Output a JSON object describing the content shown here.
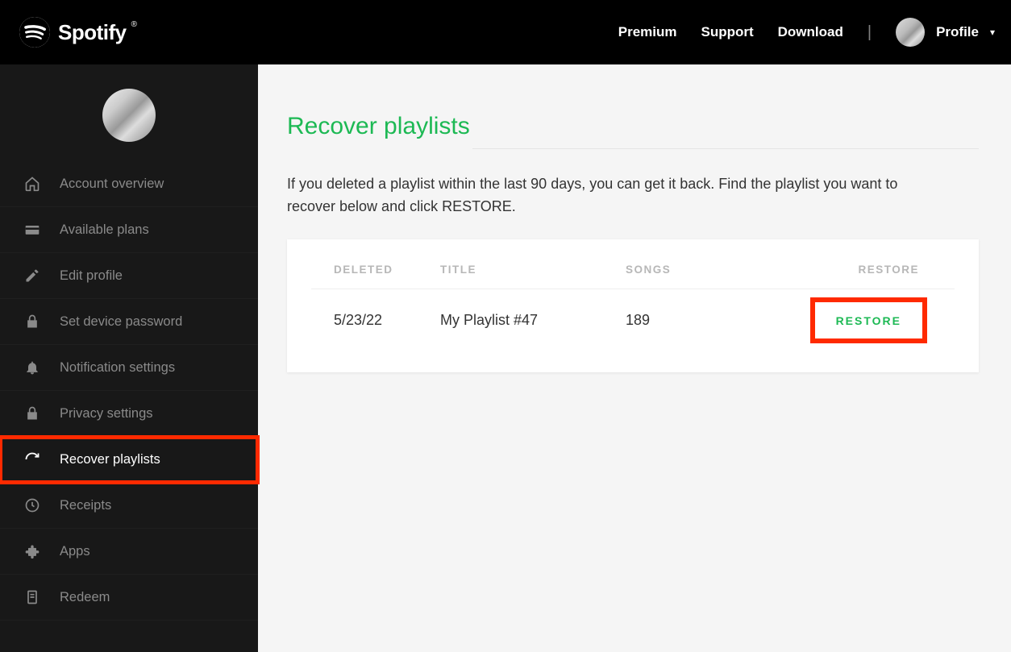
{
  "header": {
    "brand": "Spotify",
    "nav": {
      "premium": "Premium",
      "support": "Support",
      "download": "Download"
    },
    "profile_label": "Profile"
  },
  "sidebar": {
    "items": [
      {
        "label": "Account overview",
        "icon": "home-icon"
      },
      {
        "label": "Available plans",
        "icon": "card-icon"
      },
      {
        "label": "Edit profile",
        "icon": "pencil-icon"
      },
      {
        "label": "Set device password",
        "icon": "lock-icon"
      },
      {
        "label": "Notification settings",
        "icon": "bell-icon"
      },
      {
        "label": "Privacy settings",
        "icon": "lock-icon"
      },
      {
        "label": "Recover playlists",
        "icon": "refresh-icon",
        "active": true,
        "highlighted": true
      },
      {
        "label": "Receipts",
        "icon": "clock-icon"
      },
      {
        "label": "Apps",
        "icon": "puzzle-icon"
      },
      {
        "label": "Redeem",
        "icon": "receipt-icon"
      }
    ]
  },
  "main": {
    "title": "Recover playlists",
    "intro": "If you deleted a playlist within the last 90 days, you can get it back. Find the playlist you want to recover below and click RESTORE.",
    "table": {
      "headers": {
        "deleted": "DELETED",
        "title": "TITLE",
        "songs": "SONGS",
        "restore": "RESTORE"
      },
      "rows": [
        {
          "deleted": "5/23/22",
          "title": "My Playlist #47",
          "songs": "189",
          "restore_label": "RESTORE",
          "highlighted": true
        }
      ]
    }
  }
}
